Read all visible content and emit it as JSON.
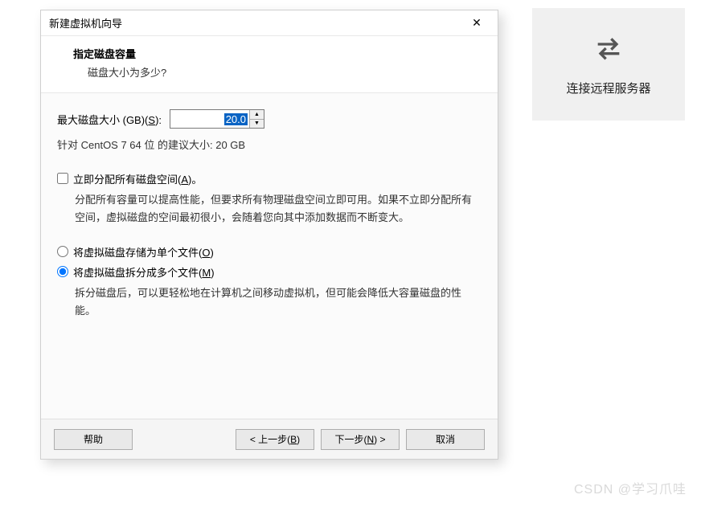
{
  "bgPanel": {
    "label": "连接远程服务器",
    "icon": "swap-arrows-icon"
  },
  "dialog": {
    "title": "新建虚拟机向导",
    "close": "✕",
    "header": {
      "title": "指定磁盘容量",
      "subtitle": "磁盘大小为多少?"
    },
    "sizeRow": {
      "label_prefix": "最大磁盘大小 (GB)(",
      "label_hotkey": "S",
      "label_suffix": "):",
      "value": "20.0"
    },
    "recommend": "针对 CentOS 7 64 位 的建议大小: 20 GB",
    "allocateNow": {
      "label_prefix": "立即分配所有磁盘空间(",
      "label_hotkey": "A",
      "label_suffix": ")。",
      "checked": false,
      "desc": "分配所有容量可以提高性能，但要求所有物理磁盘空间立即可用。如果不立即分配所有空间，虚拟磁盘的空间最初很小，会随着您向其中添加数据而不断变大。"
    },
    "storeSingle": {
      "label_prefix": "将虚拟磁盘存储为单个文件(",
      "label_hotkey": "O",
      "label_suffix": ")",
      "selected": false
    },
    "storeSplit": {
      "label_prefix": "将虚拟磁盘拆分成多个文件(",
      "label_hotkey": "M",
      "label_suffix": ")",
      "selected": true,
      "desc": "拆分磁盘后，可以更轻松地在计算机之间移动虚拟机，但可能会降低大容量磁盘的性能。"
    },
    "buttons": {
      "help": "帮助",
      "back_prefix": "< 上一步(",
      "back_hotkey": "B",
      "back_suffix": ")",
      "next_prefix": "下一步(",
      "next_hotkey": "N",
      "next_suffix": ") >",
      "cancel": "取消"
    }
  },
  "watermark": "CSDN @学习爪哇"
}
